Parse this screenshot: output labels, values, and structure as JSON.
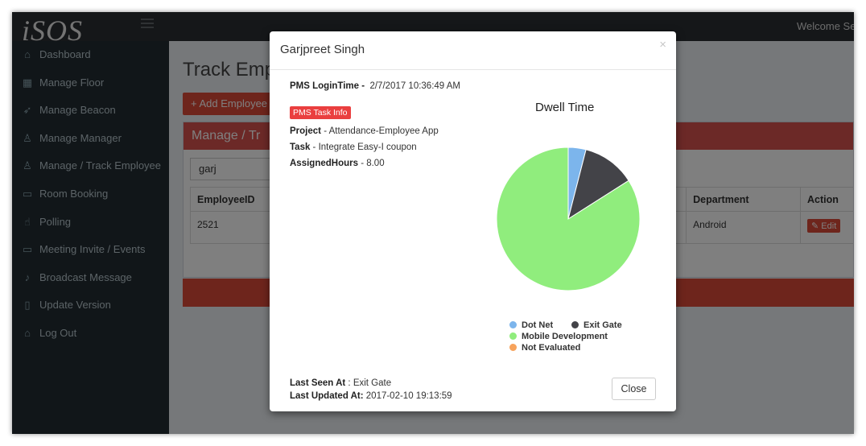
{
  "app": {
    "logo_text": "iSOS",
    "welcome_text": "Welcome Sea"
  },
  "sidebar": {
    "items": [
      {
        "label": "Dashboard",
        "icon": "home-icon",
        "glyph": "⌂"
      },
      {
        "label": "Manage Floor",
        "icon": "film-icon",
        "glyph": "▦"
      },
      {
        "label": "Manage Beacon",
        "icon": "paper-plane-icon",
        "glyph": "➶"
      },
      {
        "label": "Manage Manager",
        "icon": "user-icon",
        "glyph": "♙"
      },
      {
        "label": "Manage / Track Employee",
        "icon": "user-icon",
        "glyph": "♙"
      },
      {
        "label": "Room Booking",
        "icon": "calendar-icon",
        "glyph": "▭"
      },
      {
        "label": "Polling",
        "icon": "thumbs-up-icon",
        "glyph": "☝"
      },
      {
        "label": "Meeting Invite / Events",
        "icon": "calendar-icon",
        "glyph": "▭"
      },
      {
        "label": "Broadcast Message",
        "icon": "bell-icon",
        "glyph": "♪"
      },
      {
        "label": "Update Version",
        "icon": "mobile-icon",
        "glyph": "▯"
      },
      {
        "label": "Log Out",
        "icon": "home-icon",
        "glyph": "⌂"
      }
    ]
  },
  "main": {
    "page_title": "Track Emplo",
    "add_button": "+ Add Employee",
    "panel_title": "Manage / Tr",
    "search_value": "garj",
    "table": {
      "headers": [
        "EmployeeID",
        "Department",
        "Action"
      ],
      "rows": [
        {
          "id": "2521",
          "department": "Android",
          "action": "Edit"
        }
      ]
    }
  },
  "modal": {
    "title": "Garjpreet Singh",
    "login_label": "PMS LoginTime -",
    "login_value": "2/7/2017 10:36:49 AM",
    "task_badge": "PMS Task Info",
    "project_label": "Project",
    "project_value": " - Attendance-Employee App",
    "task_label": "Task",
    "task_value": " - Integrate Easy-I coupon",
    "hours_label": "AssignedHours",
    "hours_value": " - 8.00",
    "last_seen_label": "Last Seen At",
    "last_seen_value": " : Exit Gate",
    "last_updated_label": "Last Updated At:",
    "last_updated_value": " 2017-02-10 19:13:59",
    "close_button": "Close"
  },
  "chart_data": {
    "type": "pie",
    "title": "Dwell Time",
    "categories": [
      "Dot Net",
      "Exit Gate",
      "Mobile Development",
      "Not Evaluated"
    ],
    "values": [
      4,
      12,
      84,
      0
    ],
    "colors": [
      "#7cb5ec",
      "#434348",
      "#90ed7d",
      "#f7a35c"
    ],
    "legend": "bottom"
  }
}
